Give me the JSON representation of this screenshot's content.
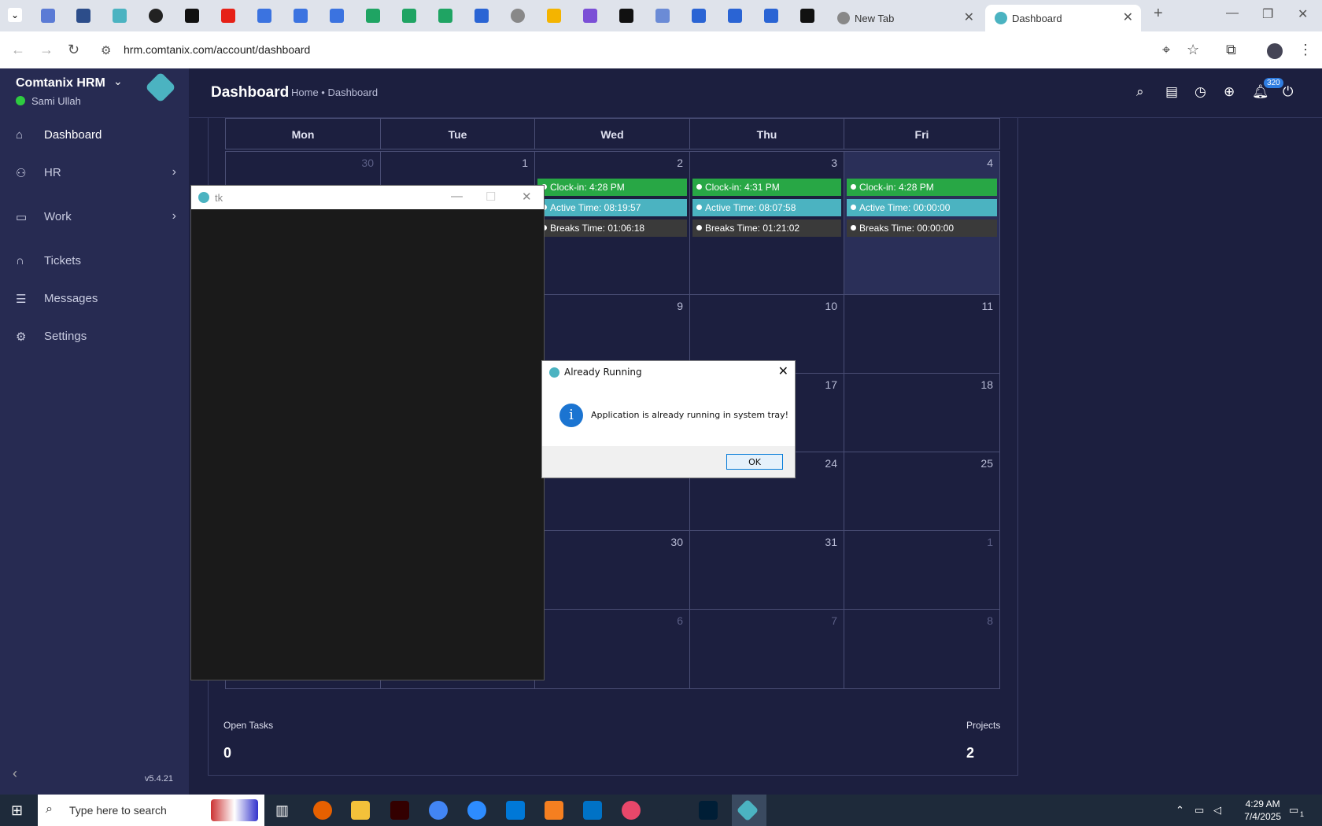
{
  "browser": {
    "url": "hrm.comtanix.com/account/dashboard",
    "tabs": [
      {
        "title": "New Tab",
        "active": false
      },
      {
        "title": "Dashboard",
        "active": true
      }
    ],
    "new_tab_label": "+"
  },
  "app": {
    "brand": "Comtanix HRM",
    "user": "Sami Ullah",
    "version": "v5.4.21",
    "nav": [
      {
        "label": "Dashboard",
        "icon": "home-icon",
        "active": true
      },
      {
        "label": "HR",
        "icon": "users-icon",
        "has_children": true
      },
      {
        "label": "Work",
        "icon": "briefcase-icon",
        "has_children": true
      },
      {
        "label": "Tickets",
        "icon": "headset-icon"
      },
      {
        "label": "Messages",
        "icon": "message-icon"
      },
      {
        "label": "Settings",
        "icon": "gear-icon"
      }
    ]
  },
  "header": {
    "title": "Dashboard",
    "breadcrumb": "Home • Dashboard",
    "notification_count": "320"
  },
  "calendar": {
    "days": [
      "Mon",
      "Tue",
      "Wed",
      "Thu",
      "Fri"
    ],
    "week1_dates": [
      "30",
      "1",
      "2",
      "3",
      "4"
    ],
    "events": {
      "wed": {
        "clock_in": "Clock-in: 4:28 PM",
        "active": "Active Time: 08:19:57",
        "breaks": "Breaks Time: 01:06:18"
      },
      "thu": {
        "clock_in": "Clock-in: 4:31 PM",
        "active": "Active Time: 08:07:58",
        "breaks": "Breaks Time: 01:21:02"
      },
      "fri": {
        "clock_in": "Clock-in: 4:28 PM",
        "active": "Active Time: 00:00:00",
        "breaks": "Breaks Time: 00:00:00"
      }
    },
    "rows": [
      [
        "9",
        "10",
        "11"
      ],
      [
        "",
        "17",
        "18"
      ],
      [
        "",
        "24",
        "25"
      ],
      [
        "30",
        "31",
        "1"
      ],
      [
        "6",
        "7",
        "8"
      ]
    ]
  },
  "stats": {
    "open_tasks_label": "Open Tasks",
    "open_tasks_value": "0",
    "projects_label": "Projects",
    "projects_value": "2"
  },
  "tk_window": {
    "title": "tk"
  },
  "dialog": {
    "title": "Already Running",
    "message": "Application is already running in system tray!",
    "ok_label": "OK"
  },
  "taskbar": {
    "search_placeholder": "Type here to search",
    "time": "4:29 AM",
    "date": "7/4/2025",
    "notification_count": "1"
  },
  "colors": {
    "sidebar_bg": "#272b52",
    "main_bg": "#1c1f3f",
    "clock_in": "#28a745",
    "active_time": "#4bb3c1",
    "breaks": "#3a3a3a"
  }
}
